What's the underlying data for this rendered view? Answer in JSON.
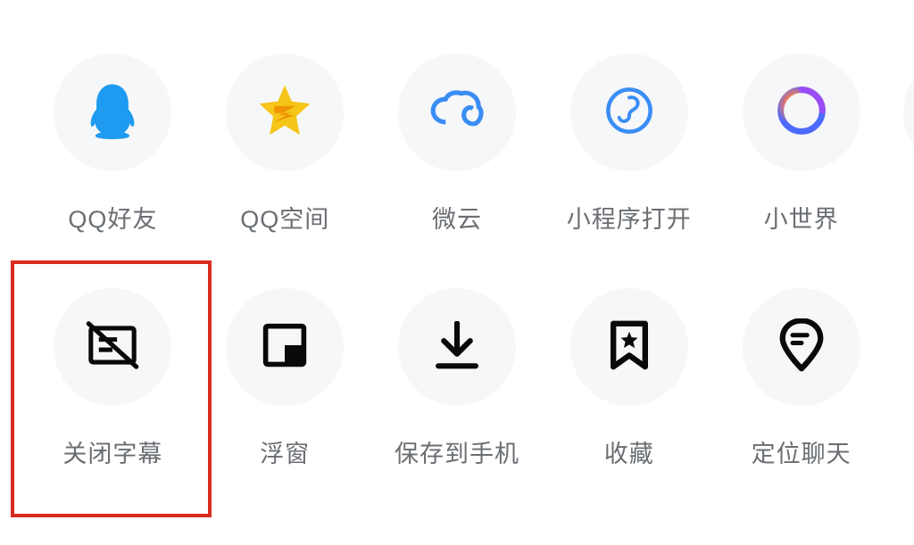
{
  "row1": [
    {
      "label": "QQ好友",
      "icon": "qq-friend-icon"
    },
    {
      "label": "QQ空间",
      "icon": "qzone-icon"
    },
    {
      "label": "微云",
      "icon": "weiyun-icon"
    },
    {
      "label": "小程序打开",
      "icon": "miniprogram-icon"
    },
    {
      "label": "小世界",
      "icon": "small-world-icon"
    }
  ],
  "row2": [
    {
      "label": "关闭字幕",
      "icon": "close-caption-icon"
    },
    {
      "label": "浮窗",
      "icon": "float-window-icon"
    },
    {
      "label": "保存到手机",
      "icon": "download-icon"
    },
    {
      "label": "收藏",
      "icon": "favorite-icon"
    },
    {
      "label": "定位聊天",
      "icon": "locate-chat-icon"
    }
  ],
  "colors": {
    "highlight": "#d92b1f",
    "circle_bg": "#f6f7f8",
    "text": "#6a6e72"
  }
}
